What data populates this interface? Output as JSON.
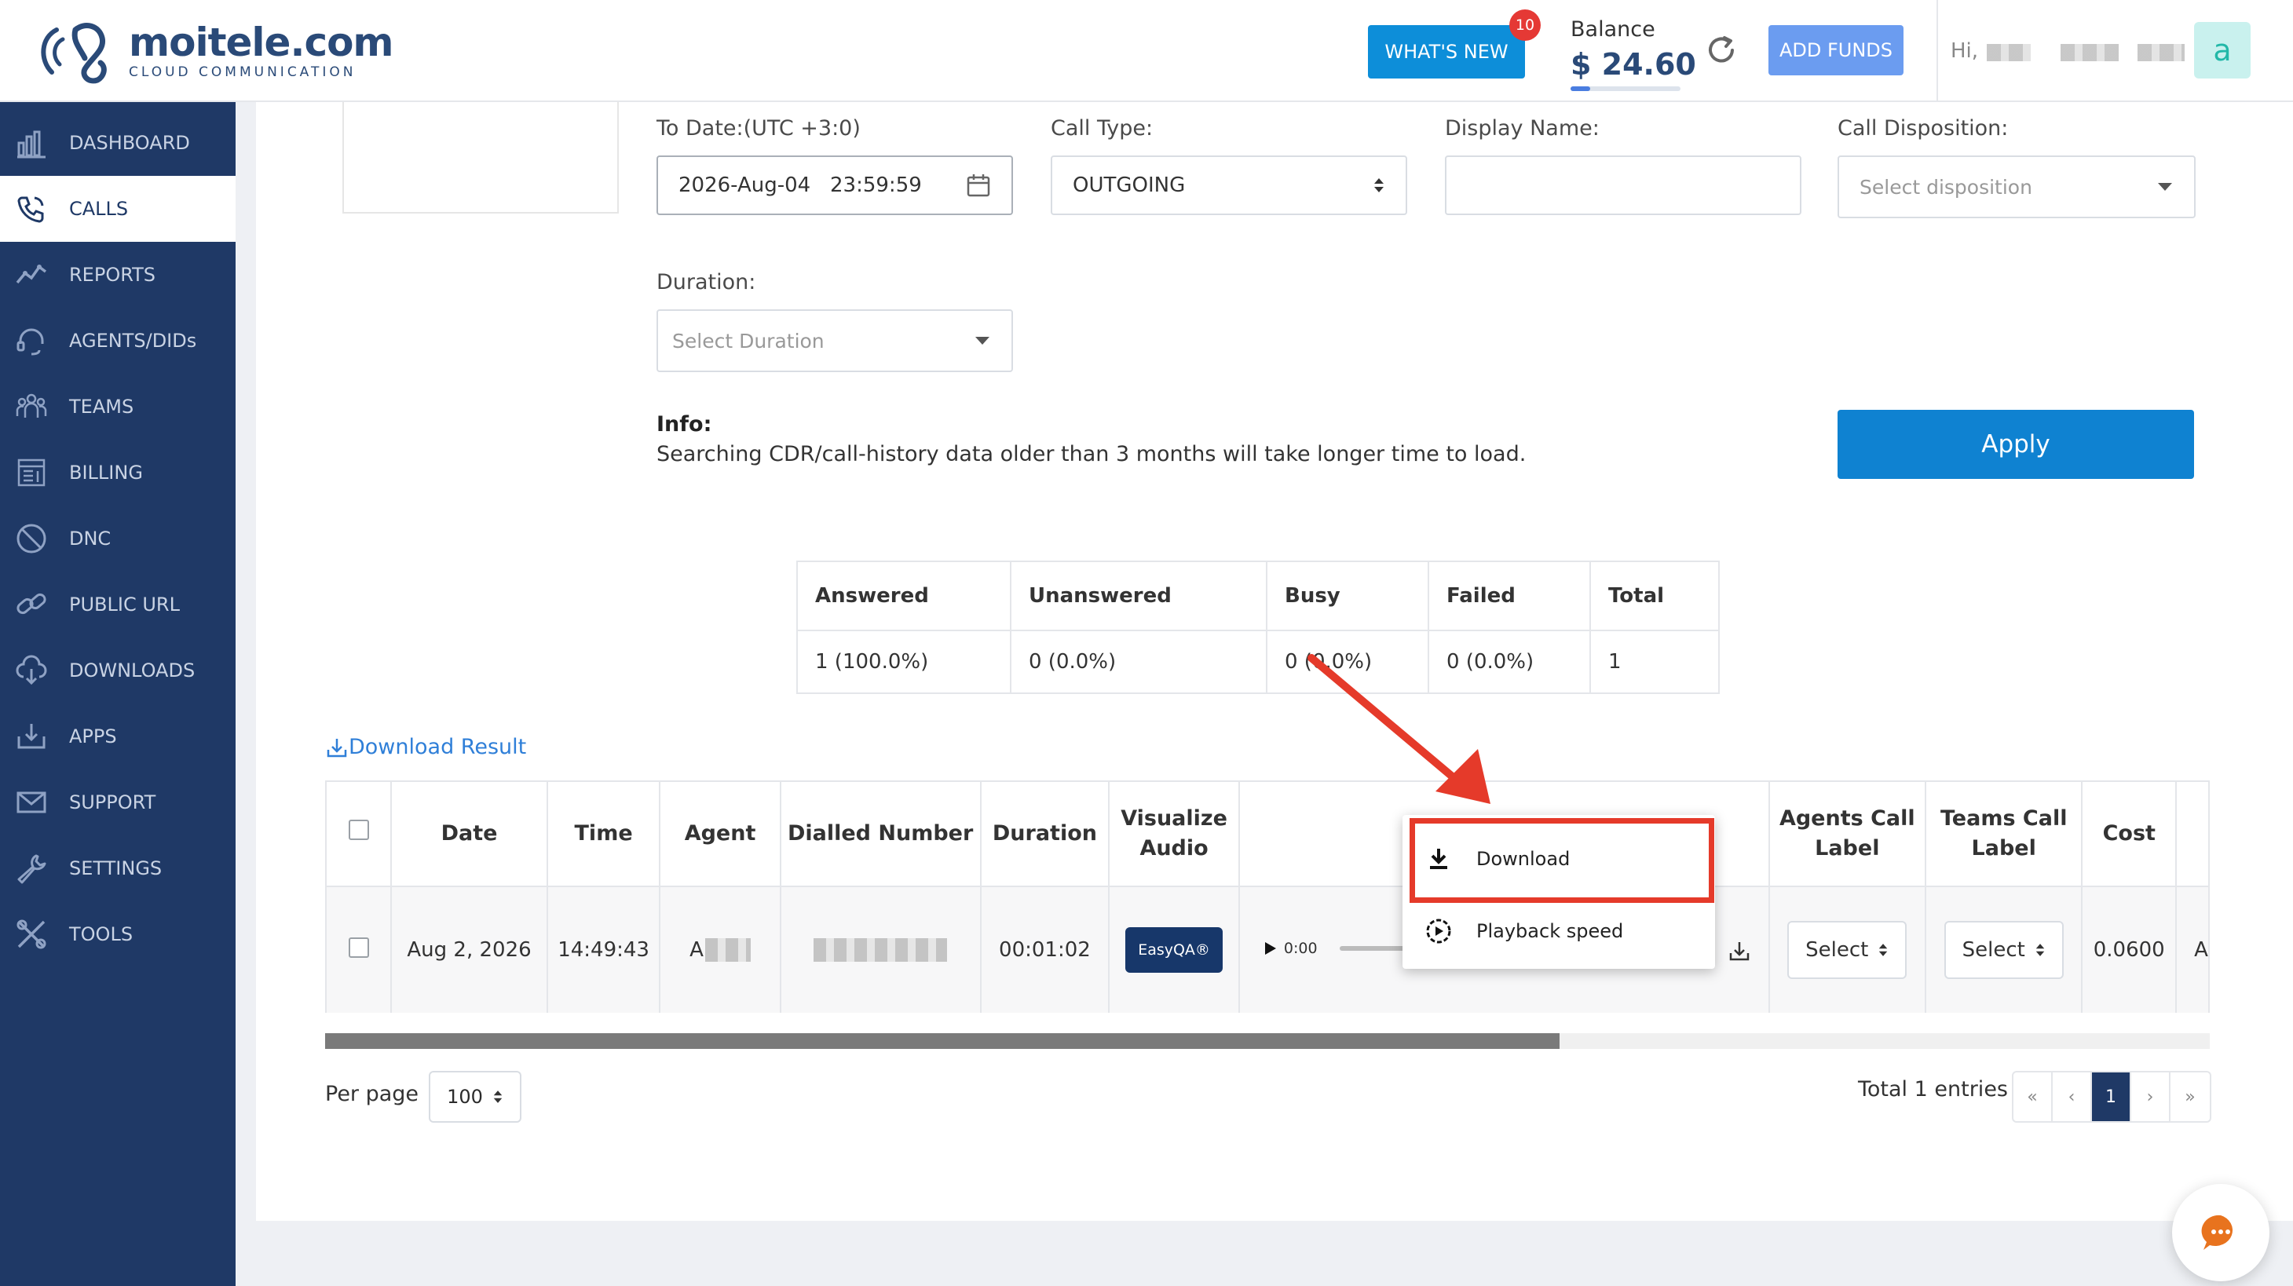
{
  "header": {
    "logo_name": "moitele.com",
    "logo_sub": "CLOUD COMMUNICATION",
    "whats_new": "WHAT'S NEW",
    "notification_count": "10",
    "balance_label": "Balance",
    "balance_value": "$ 24.60",
    "add_funds": "ADD FUNDS",
    "greeting": "Hi,",
    "avatar_letter": "a"
  },
  "sidebar": {
    "items": [
      {
        "label": "DASHBOARD",
        "icon": "chart-bars-icon"
      },
      {
        "label": "CALLS",
        "icon": "phone-icon"
      },
      {
        "label": "REPORTS",
        "icon": "trend-line-icon"
      },
      {
        "label": "AGENTS/DIDs",
        "icon": "headset-icon"
      },
      {
        "label": "TEAMS",
        "icon": "team-icon"
      },
      {
        "label": "BILLING",
        "icon": "invoice-icon"
      },
      {
        "label": "DNC",
        "icon": "block-icon"
      },
      {
        "label": "PUBLIC URL",
        "icon": "link-icon"
      },
      {
        "label": "DOWNLOADS",
        "icon": "cloud-download-icon"
      },
      {
        "label": "APPS",
        "icon": "tray-download-icon"
      },
      {
        "label": "SUPPORT",
        "icon": "mail-icon"
      },
      {
        "label": "SETTINGS",
        "icon": "wrench-icon"
      },
      {
        "label": "TOOLS",
        "icon": "tools-icon"
      }
    ]
  },
  "filters": {
    "to_date_label": "To Date:(UTC +3:0)",
    "to_date_value": "2026-Aug-04   23:59:59",
    "call_type_label": "Call Type:",
    "call_type_value": "OUTGOING",
    "display_name_label": "Display Name:",
    "display_name_value": "",
    "call_disposition_label": "Call Disposition:",
    "call_disposition_placeholder": "Select disposition",
    "duration_label": "Duration:",
    "duration_placeholder": "Select Duration",
    "info_title": "Info:",
    "info_text": "Searching CDR/call-history data older than 3 months will take longer time to load.",
    "apply": "Apply"
  },
  "summary": {
    "headers": [
      "Answered",
      "Unanswered",
      "Busy",
      "Failed",
      "Total"
    ],
    "values": [
      "1 (100.0%)",
      "0 (0.0%)",
      "0 (0.0%)",
      "0 (0.0%)",
      "1"
    ]
  },
  "download_result": "Download Result",
  "table": {
    "headers": [
      "Date",
      "Time",
      "Agent",
      "Dialled Number",
      "Duration",
      "Visualize Audio",
      "",
      "Agents Call Label",
      "Teams Call Label",
      "Cost"
    ],
    "row": {
      "date": "Aug 2, 2026",
      "time": "14:49:43",
      "agent_prefix": "A",
      "duration": "00:01:02",
      "easyqa": "EasyQA®",
      "audio_time": "0:00",
      "agent_label_select": "Select",
      "team_label_select": "Select",
      "cost": "0.0600",
      "overflow_char": "A"
    }
  },
  "context_menu": {
    "download": "Download",
    "playback_speed": "Playback speed"
  },
  "pagination": {
    "per_page_label": "Per page",
    "per_page_value": "100",
    "total_text": "Total 1 entries",
    "pages": [
      "«",
      "‹",
      "1",
      "›",
      "»"
    ]
  },
  "colors": {
    "sidebar": "#1f3966",
    "accent": "#0f82d1",
    "highlight": "#e53a2a"
  }
}
